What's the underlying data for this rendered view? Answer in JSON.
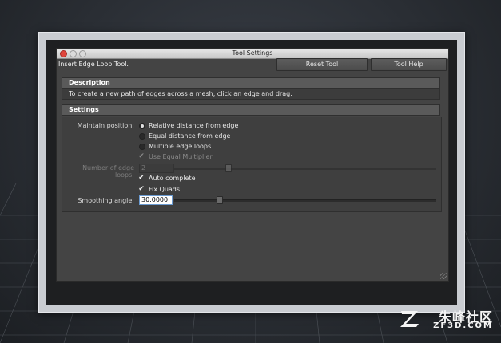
{
  "window": {
    "title": "Tool Settings",
    "tool_name": "Insert Edge Loop Tool.",
    "buttons": {
      "reset": "Reset Tool",
      "help": "Tool Help"
    }
  },
  "description": {
    "header": "Description",
    "text": "To create a new path of edges across a mesh, click an edge and drag."
  },
  "settings": {
    "header": "Settings",
    "maintain_position": {
      "label": "Maintain position:",
      "options": [
        "Relative distance from edge",
        "Equal distance from edge",
        "Multiple edge loops"
      ],
      "selected": 0
    },
    "use_equal_multiplier": {
      "label": "Use Equal Multiplier",
      "checked": true,
      "disabled": true
    },
    "number_of_edge_loops": {
      "label": "Number of edge loops:",
      "value": "2",
      "disabled": true
    },
    "auto_complete": {
      "label": "Auto complete",
      "checked": true
    },
    "fix_quads": {
      "label": "Fix Quads",
      "checked": true
    },
    "smoothing_angle": {
      "label": "Smoothing angle:",
      "value": "30.0000"
    }
  },
  "watermark": {
    "cn": "朱峰社区",
    "en": "ZF3D.COM"
  },
  "colors": {
    "close": "#e0463d",
    "panel": "#444444",
    "header": "#5a5a5a"
  }
}
